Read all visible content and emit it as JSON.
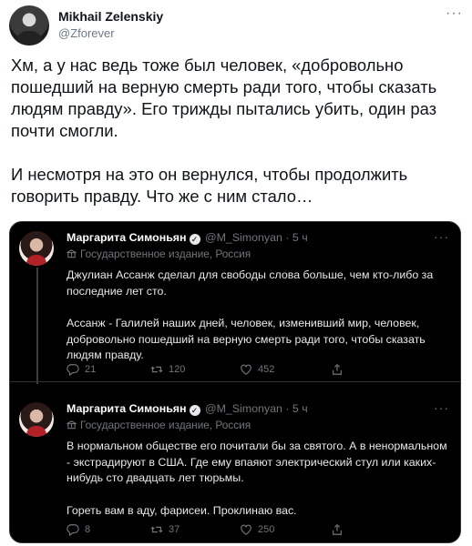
{
  "author": {
    "name": "Mikhail Zelenskiy",
    "handle": "@Zforever",
    "more": "···"
  },
  "tweet": {
    "paragraphs": [
      "Хм, а у нас ведь тоже был человек, «добровольно пошедший на верную смерть ради того, чтобы сказать людям правду». Его трижды пытались убить, один раз почти смогли.",
      "И несмотря на это он вернулся, чтобы продолжить говорить правду. Что же с ним стало…"
    ]
  },
  "embed": {
    "posts": [
      {
        "name": "Маргарита Симоньян",
        "verified": "✓",
        "handle": "@M_Simonyan",
        "dot": "·",
        "time": "5 ч",
        "label": "Государственное издание, Россия",
        "more": "···",
        "paragraphs": [
          "Джулиан Ассанж сделал для свободы слова больше, чем кто-либо за последние лет сто.",
          "Ассанж - Галилей наших дней, человек, изменивший мир, человек, добровольно пошедший на верную смерть ради того, чтобы сказать людям правду."
        ],
        "replies": "21",
        "retweets": "120",
        "likes": "452"
      },
      {
        "name": "Маргарита Симоньян",
        "verified": "✓",
        "handle": "@M_Simonyan",
        "dot": "·",
        "time": "5 ч",
        "label": "Государственное издание, Россия",
        "more": "···",
        "paragraphs": [
          "В нормальном обществе его почитали бы за святого. А в ненормальном - экстрадируют в США. Где ему впаяют электрический стул или каких-нибудь сто двадцать лет тюрьмы.",
          "Гореть вам в аду, фарисеи. Проклинаю вас."
        ],
        "replies": "8",
        "retweets": "37",
        "likes": "250"
      }
    ]
  },
  "icons": {
    "reply": "reply-icon",
    "retweet": "retweet-icon",
    "like": "like-icon",
    "share": "share-icon",
    "state_media": "state-media-icon"
  },
  "colors": {
    "embed_bg": "#000000",
    "muted": "#71767b",
    "text_dark": "#e7e9ea",
    "accent_dress": "#b22028"
  }
}
